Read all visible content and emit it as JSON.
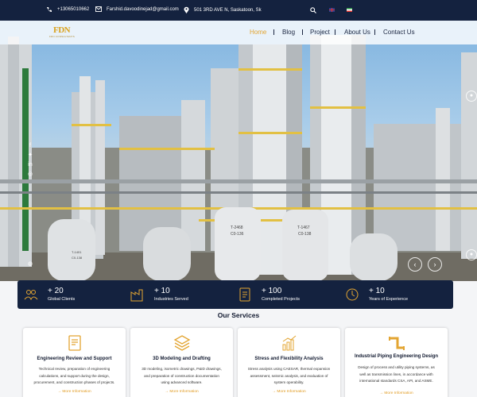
{
  "topbar": {
    "phone": "+13065010662",
    "email": "Farshid.davoodinejad@gmail.com",
    "address": "501 3RD AVE N, Saskatoon, Sk"
  },
  "brand": {
    "mark": "FDN",
    "tagline": "FDN CONSULTANTS"
  },
  "nav": [
    {
      "label": "Home"
    },
    {
      "label": "Blog"
    },
    {
      "label": "Project"
    },
    {
      "label": "About Us"
    },
    {
      "label": "Contact Us"
    }
  ],
  "hero": {
    "tank_labels": [
      "T-1467",
      "C0-138",
      "T-2468",
      "C0-136",
      "T-1401",
      "C0-138"
    ]
  },
  "stats": [
    {
      "value": "+ 20",
      "label": "Global Clients"
    },
    {
      "value": "+ 10",
      "label": "Industries Served"
    },
    {
      "value": "+ 100",
      "label": "Completed Projects"
    },
    {
      "value": "+ 10",
      "label": "Years of Experience"
    }
  ],
  "services": {
    "title": "Our Services",
    "cards": [
      {
        "title": "Engineering Review and Support",
        "lines": [
          "Technical review, preparation of engineering",
          "calculations, and support during the design,",
          "procurement, and construction phases of projects."
        ],
        "more": "→ More Information"
      },
      {
        "title": "3D Modeling and Drafting",
        "lines": [
          "3D modeling, isometric drawings, P&ID drawings,",
          "and preparation of construction documentation",
          "using advanced software."
        ],
        "more": "→ More Information"
      },
      {
        "title": "Stress and Flexibility Analysis",
        "lines": [
          "Stress analysis using CAESAR, thermal expansion",
          "assessment, seismic analysis, and evaluation of",
          "system operability."
        ],
        "more": "→ More Information"
      },
      {
        "title": "Industrial Piping Engineering Design",
        "lines": [
          "Design of process and utility piping systems, as",
          "well as transmission lines, in accordance with",
          "international standards CSA, API, and ASME."
        ],
        "more": "→ More Information"
      }
    ]
  },
  "colors": {
    "navy": "#14223f",
    "accent": "#e3a532"
  }
}
